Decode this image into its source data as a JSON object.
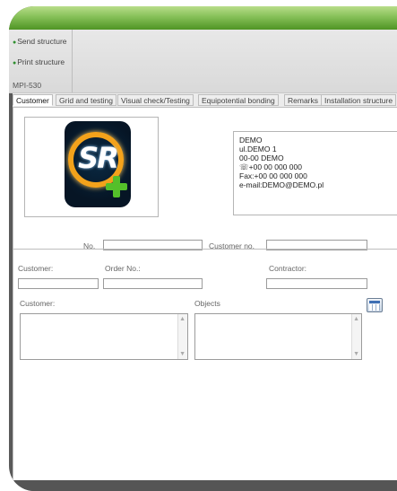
{
  "toolbar": {
    "send_structure": "Send structure",
    "print_structure": "Print structure",
    "section": "MPI-530"
  },
  "tabs": [
    {
      "label": "Customer",
      "active": true
    },
    {
      "label": "Grid and testing",
      "active": false
    },
    {
      "label": "Visual check/Testing",
      "active": false
    },
    {
      "label": "Equipotential bonding",
      "active": false
    },
    {
      "label": "Remarks",
      "active": false
    },
    {
      "label": "Installation structure",
      "active": false
    }
  ],
  "logo": {
    "text": "SR"
  },
  "address": {
    "lines": [
      "DEMO",
      "ul.DEMO 1",
      "00-00 DEMO",
      "☏+00 00 000 000",
      "Fax:+00 00 000 000",
      "e-mail:DEMO@DEMO.pl"
    ]
  },
  "form": {
    "no_label": "No.",
    "no_value": "",
    "customer_no_label": "Customer no.",
    "customer_no_value": "",
    "customer_label": "Customer:",
    "customer_value": "",
    "order_no_label": "Order No.:",
    "order_no_value": "",
    "contractor_label": "Contractor:",
    "contractor_value": "",
    "customer_notes_label": "Customer:",
    "customer_notes_value": "",
    "objects_label": "Objects",
    "objects_value": ""
  },
  "icons": {
    "send": "green-dot-icon",
    "print": "green-dot-icon",
    "calendar": "calendar-icon",
    "scroll_up": "chevron-up-icon",
    "scroll_down": "chevron-down-icon"
  },
  "colors": {
    "titlebar_green": "#6fae3c",
    "frame_gray": "#5a5a5a",
    "logo_orange": "#f3a21b",
    "logo_plus_green": "#54c02a"
  }
}
